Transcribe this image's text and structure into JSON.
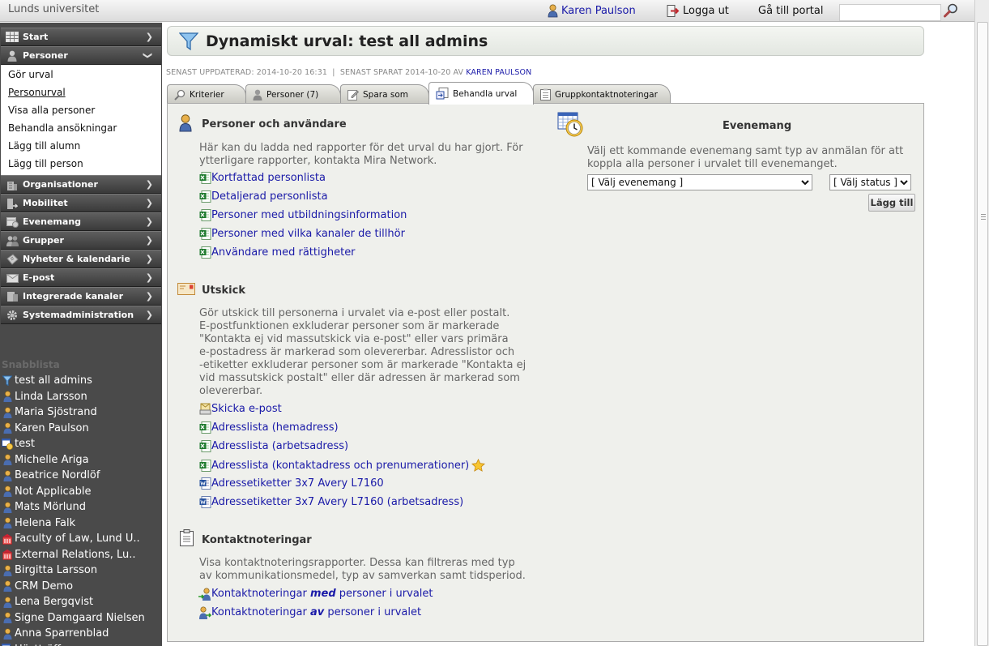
{
  "topbar": {
    "org_name": "Lunds universitet",
    "user_name": "Karen Paulson",
    "logout_label": "Logga ut",
    "portal_label": "Gå till portal",
    "search_placeholder": ""
  },
  "sidebar": {
    "items": [
      {
        "label": "Start",
        "icon": "calendar-grid-icon"
      },
      {
        "label": "Personer",
        "icon": "person-icon",
        "expanded": true
      },
      {
        "label": "Organisationer",
        "icon": "building-icon"
      },
      {
        "label": "Mobilitet",
        "icon": "mobility-icon"
      },
      {
        "label": "Evenemang",
        "icon": "event-icon"
      },
      {
        "label": "Grupper",
        "icon": "group-icon"
      },
      {
        "label": "Nyheter & kalendarie",
        "icon": "news-icon"
      },
      {
        "label": "E-post",
        "icon": "envelope-icon"
      },
      {
        "label": "Integrerade kanaler",
        "icon": "channels-icon"
      },
      {
        "label": "Systemadministration",
        "icon": "gear-icon"
      }
    ],
    "personer_sub": [
      "Gör urval",
      "Personurval",
      "Visa alla personer",
      "Behandla ansökningar",
      "Lägg till alumn",
      "Lägg till person"
    ],
    "quicklist_title": "Snabblista",
    "quicklist": [
      {
        "label": "test all admins",
        "icon": "funnel-icon"
      },
      {
        "label": "Linda Larsson",
        "icon": "person-icon"
      },
      {
        "label": "Maria Sjöstrand",
        "icon": "person-icon"
      },
      {
        "label": "Karen Paulson",
        "icon": "person-icon"
      },
      {
        "label": "test",
        "icon": "event-icon"
      },
      {
        "label": "Michelle Ariga",
        "icon": "person-icon"
      },
      {
        "label": "Beatrice Nordlöf",
        "icon": "person-icon"
      },
      {
        "label": "Not Applicable",
        "icon": "person-icon"
      },
      {
        "label": "Mats Mörlund",
        "icon": "person-icon"
      },
      {
        "label": "Helena Falk",
        "icon": "person-icon"
      },
      {
        "label": "Faculty of Law, Lund U..",
        "icon": "building-icon"
      },
      {
        "label": "External Relations, Lu..",
        "icon": "building-icon"
      },
      {
        "label": "Birgitta Larsson",
        "icon": "person-icon"
      },
      {
        "label": "CRM Demo",
        "icon": "person-icon"
      },
      {
        "label": "Lena Bergqvist",
        "icon": "person-icon"
      },
      {
        "label": "Signe Damgaard Nielsen",
        "icon": "person-icon"
      },
      {
        "label": "Anna Sparrenblad",
        "icon": "person-icon"
      },
      {
        "label": "Höstträff",
        "icon": "event-icon"
      }
    ]
  },
  "header": {
    "title": "Dynamiskt urval: test all admins"
  },
  "meta": {
    "updated_label": "SENAST UPPDATERAD:",
    "updated_value": "2014-10-20 16:31",
    "separator": "|",
    "saved_label": "SENAST SPARAT",
    "saved_value": "2014-10-20",
    "by_label": "AV",
    "saved_by": "KAREN PAULSON"
  },
  "tabs": [
    {
      "label": "Kriterier",
      "icon": "magnifier-icon"
    },
    {
      "label": "Personer (7)",
      "icon": "person-icon"
    },
    {
      "label": "Spara som",
      "icon": "edit-icon"
    },
    {
      "label": "Behandla urval",
      "icon": "process-icon",
      "active": true
    },
    {
      "label": "Gruppkontaktnoteringar",
      "icon": "notes-icon"
    }
  ],
  "sections": {
    "personer": {
      "title": "Personer och användare",
      "desc_lines": [
        "Här kan du ladda ned rapporter för det urval du har gjort. För",
        "ytterligare rapporter, kontakta Mira Network."
      ],
      "links": [
        "Kortfattad personlista",
        "Detaljerad personlista",
        "Personer med utbildningsinformation",
        "Personer med vilka kanaler de tillhör",
        "Användare med rättigheter"
      ]
    },
    "utskick": {
      "title": "Utskick",
      "desc_lines": [
        "Gör utskick till personerna i urvalet via e-post eller postalt.",
        "E-postfunktionen exkluderar personer som är markerade",
        "\"Kontakta ej vid massutskick via e-post\" eller vars primära",
        "e-postadress är markerad som olevererbar. Adresslistor och",
        "-etiketter exkluderar personer som är markerade \"Kontakta ej",
        "vid massutskick postalt\" eller där adressen är markerad som",
        "olevererbar."
      ],
      "links": [
        {
          "label": "Skicka e-post",
          "icon": "email-send-icon"
        },
        {
          "label": "Adresslista (hemadress)",
          "icon": "excel-icon"
        },
        {
          "label": "Adresslista (arbetsadress)",
          "icon": "excel-icon"
        },
        {
          "label": "Adresslista (kontaktadress och prenumerationer)",
          "icon": "excel-icon",
          "star": true
        },
        {
          "label": "Adressetiketter 3x7 Avery L7160",
          "icon": "word-icon"
        },
        {
          "label": "Adressetiketter 3x7 Avery L7160 (arbetsadress)",
          "icon": "word-icon"
        }
      ]
    },
    "kontakt": {
      "title": "Kontaktnoteringar",
      "desc_lines": [
        "Visa kontaktnoteringsrapporter. Dessa kan filtreras med typ",
        "av kommunikationsmedel, typ av samverkan samt tidsperiod."
      ],
      "link1": {
        "pre": "Kontaktnoteringar ",
        "em": "med",
        "post": " personer i urvalet"
      },
      "link2": {
        "pre": "Kontaktnoteringar ",
        "em": "av",
        "post": " personer i urvalet"
      }
    },
    "evenemang": {
      "title": "Evenemang",
      "desc_lines": [
        "Välj ett kommande evenemang samt typ av anmälan för att",
        "koppla alla personer i urvalet till evenemanget."
      ],
      "event_select": "[ Välj evenemang ]",
      "status_select": "[ Välj status ]",
      "add_label": "Lägg till"
    }
  }
}
